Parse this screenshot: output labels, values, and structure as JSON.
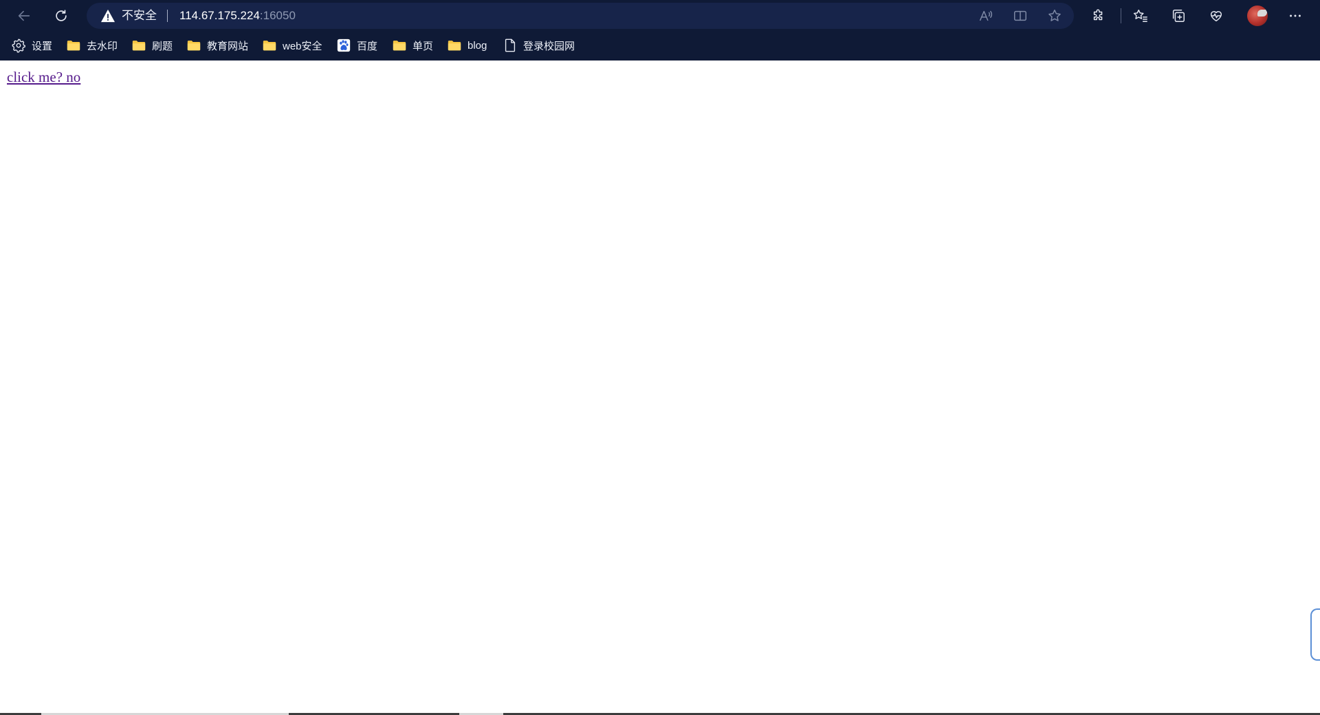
{
  "address_bar": {
    "security_label": "不安全",
    "url_host": "114.67.175.224",
    "url_port": ":16050"
  },
  "bookmarks": [
    {
      "label": "设置",
      "icon": "gear-icon"
    },
    {
      "label": "去水印",
      "icon": "folder-icon"
    },
    {
      "label": "刷题",
      "icon": "folder-icon"
    },
    {
      "label": "教育网站",
      "icon": "folder-icon"
    },
    {
      "label": "web安全",
      "icon": "folder-icon"
    },
    {
      "label": "百度",
      "icon": "baidu-paw-icon"
    },
    {
      "label": "单页",
      "icon": "folder-icon"
    },
    {
      "label": "blog",
      "icon": "folder-icon"
    },
    {
      "label": "登录校园网",
      "icon": "page-icon"
    }
  ],
  "page": {
    "link_text": "click me? no"
  },
  "colors": {
    "chrome_bg": "#0f1a36",
    "address_bg": "#17244a",
    "folder": "#f5c542",
    "visited_link": "#551a8b"
  }
}
